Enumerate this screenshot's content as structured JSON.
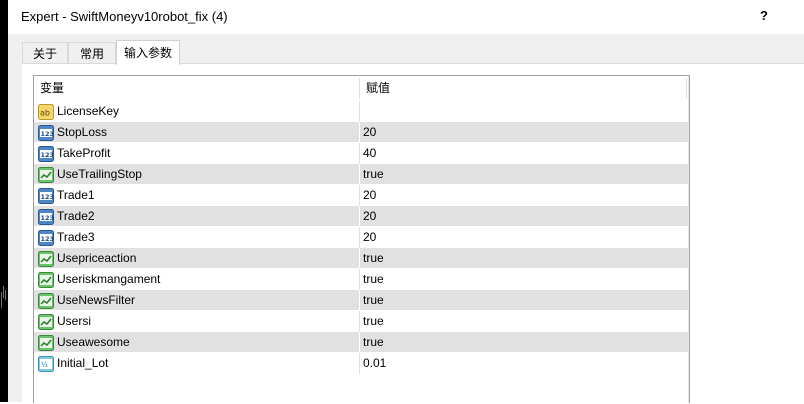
{
  "window": {
    "title": "Expert - SwiftMoneyv10robot_fix (4)",
    "help_label": "?"
  },
  "tabs": [
    {
      "label": "关于",
      "active": false
    },
    {
      "label": "常用",
      "active": false
    },
    {
      "label": "输入参数",
      "active": true
    }
  ],
  "grid": {
    "columns": {
      "variable": "变量",
      "value": "赋值"
    },
    "rows": [
      {
        "icon": "string-type-icon",
        "name": "LicenseKey",
        "value": ""
      },
      {
        "icon": "integer-type-icon",
        "name": "StopLoss",
        "value": "20"
      },
      {
        "icon": "integer-type-icon",
        "name": "TakeProfit",
        "value": "40"
      },
      {
        "icon": "boolean-type-icon",
        "name": "UseTrailingStop",
        "value": "true"
      },
      {
        "icon": "integer-type-icon",
        "name": "Trade1",
        "value": "20"
      },
      {
        "icon": "integer-type-icon",
        "name": "Trade2",
        "value": "20"
      },
      {
        "icon": "integer-type-icon",
        "name": "Trade3",
        "value": "20"
      },
      {
        "icon": "boolean-type-icon",
        "name": "Usepriceaction",
        "value": "true"
      },
      {
        "icon": "boolean-type-icon",
        "name": "Useriskmangament",
        "value": "true"
      },
      {
        "icon": "boolean-type-icon",
        "name": "UseNewsFilter",
        "value": "true"
      },
      {
        "icon": "boolean-type-icon",
        "name": "Usersi",
        "value": "true"
      },
      {
        "icon": "boolean-type-icon",
        "name": "Useawesome",
        "value": "true"
      },
      {
        "icon": "double-type-icon",
        "name": "Initial_Lot",
        "value": "0.01"
      }
    ]
  },
  "colors": {
    "row_alt": "#e1e1e1",
    "chart_background": "#000000",
    "chart_candle": "#00c000"
  }
}
